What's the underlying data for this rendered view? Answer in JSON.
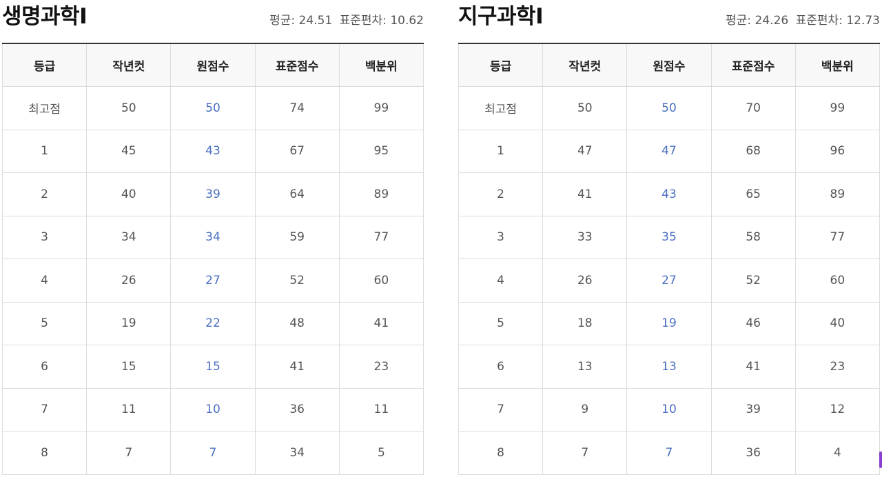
{
  "panels": [
    {
      "title": "생명과학Ⅰ",
      "stats": {
        "mean": "평균: 24.51",
        "sd": "표준편차: 10.62"
      },
      "columns": [
        "등급",
        "작년컷",
        "원점수",
        "표준점수",
        "백분위"
      ],
      "rows": [
        [
          "최고점",
          "50",
          "50",
          "74",
          "99"
        ],
        [
          "1",
          "45",
          "43",
          "67",
          "95"
        ],
        [
          "2",
          "40",
          "39",
          "64",
          "89"
        ],
        [
          "3",
          "34",
          "34",
          "59",
          "77"
        ],
        [
          "4",
          "26",
          "27",
          "52",
          "60"
        ],
        [
          "5",
          "19",
          "22",
          "48",
          "41"
        ],
        [
          "6",
          "15",
          "15",
          "41",
          "23"
        ],
        [
          "7",
          "11",
          "10",
          "36",
          "11"
        ],
        [
          "8",
          "7",
          "7",
          "34",
          "5"
        ]
      ]
    },
    {
      "title": "지구과학Ⅰ",
      "stats": {
        "mean": "평균: 24.26",
        "sd": "표준편차: 12.73"
      },
      "columns": [
        "등급",
        "작년컷",
        "원점수",
        "표준점수",
        "백분위"
      ],
      "rows": [
        [
          "최고점",
          "50",
          "50",
          "70",
          "99"
        ],
        [
          "1",
          "47",
          "47",
          "68",
          "96"
        ],
        [
          "2",
          "41",
          "43",
          "65",
          "89"
        ],
        [
          "3",
          "33",
          "35",
          "58",
          "77"
        ],
        [
          "4",
          "26",
          "27",
          "52",
          "60"
        ],
        [
          "5",
          "18",
          "19",
          "46",
          "40"
        ],
        [
          "6",
          "13",
          "13",
          "41",
          "23"
        ],
        [
          "7",
          "9",
          "10",
          "39",
          "12"
        ],
        [
          "8",
          "7",
          "7",
          "36",
          "4"
        ]
      ]
    }
  ],
  "colors": {
    "raw_score_text": "#4a6fc1",
    "header_bg": "#f8f8f8",
    "accent_scroll": "#8a3fd1"
  }
}
